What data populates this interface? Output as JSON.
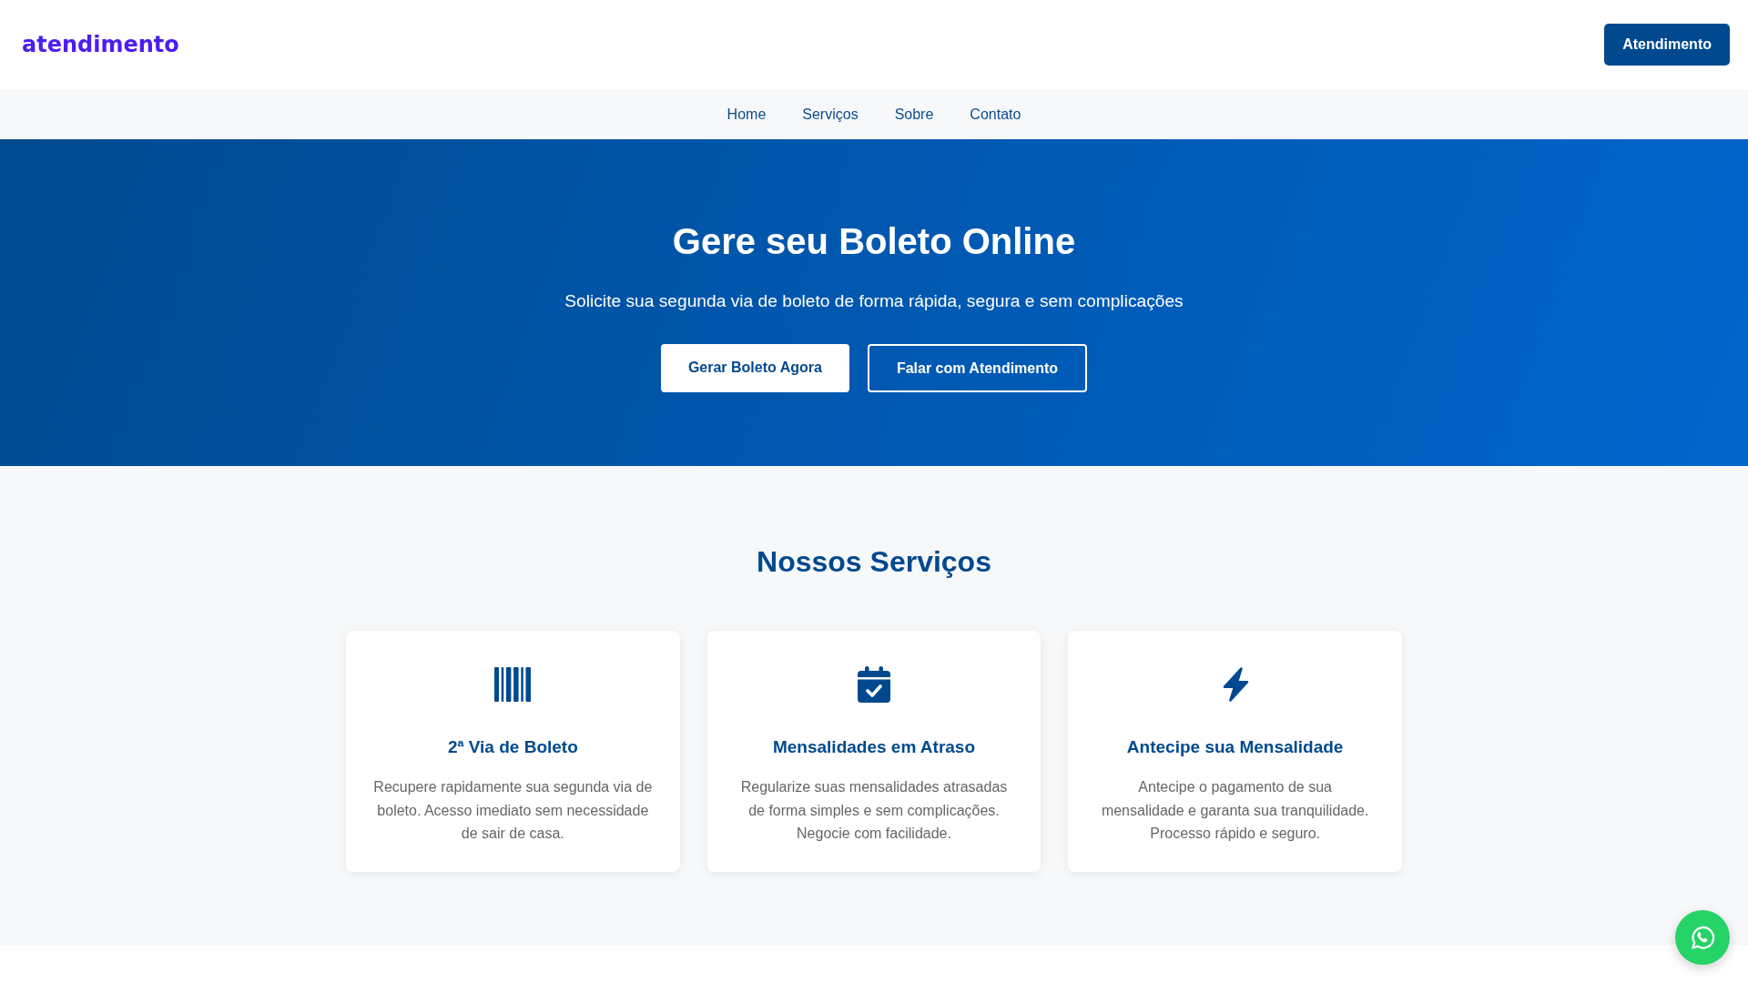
{
  "header": {
    "logo": "atendimento",
    "button": "Atendimento"
  },
  "nav": {
    "items": [
      "Home",
      "Serviços",
      "Sobre",
      "Contato"
    ]
  },
  "hero": {
    "title": "Gere seu Boleto Online",
    "subtitle": "Solicite sua segunda via de boleto de forma rápida, segura e sem complicações",
    "buttons": [
      {
        "label": "Gerar Boleto Agora",
        "kind": "solid"
      },
      {
        "label": "Falar com Atendimento",
        "kind": "outline"
      }
    ]
  },
  "services": {
    "title": "Nossos Serviços",
    "cards": [
      {
        "title": "2ª Via de Boleto",
        "description": "Recupere rapidamente sua segunda via de boleto. Acesso imediato sem necessidade de sair de casa."
      },
      {
        "title": "Mensalidades em Atraso",
        "description": "Regularize suas mensalidades atrasadas de forma simples e sem complicações. Negocie com facilidade."
      },
      {
        "title": "Antecipe sua Mensalidade",
        "description": "Antecipe o pagamento de sua mensalidade e garanta sua tranquilidade. Processo rápido e seguro."
      }
    ]
  }
}
